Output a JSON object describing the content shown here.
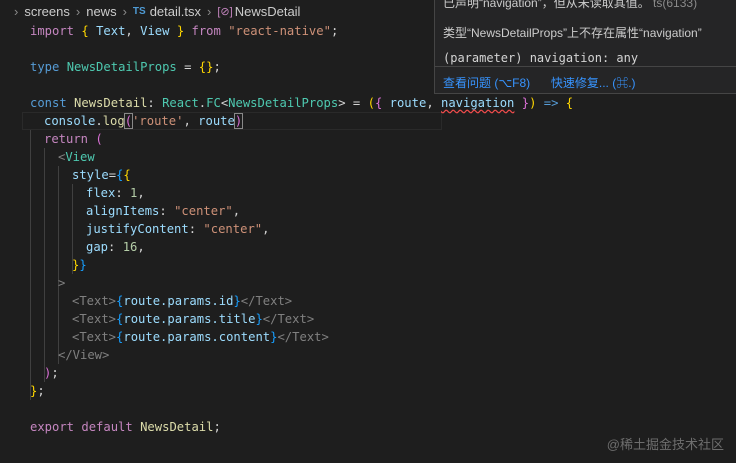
{
  "breadcrumb": {
    "items": [
      "screens",
      "news",
      "detail.tsx",
      "NewsDetail"
    ],
    "ts_badge": "TS",
    "sym_icon": "[⊘]"
  },
  "code": {
    "l1": [
      "import",
      "{",
      "Text",
      ",",
      "View",
      "}",
      "from",
      "\"react-native\"",
      ";"
    ],
    "l3": [
      "type",
      "NewsDetailProps",
      "=",
      "{}",
      ";"
    ],
    "l5": [
      "const",
      "NewsDetail",
      ":",
      "React",
      ".",
      "FC",
      "<",
      "NewsDetailProps",
      ">",
      "=",
      "(",
      "{",
      "route",
      ",",
      "navigation",
      "}",
      ")",
      "=>",
      "{"
    ],
    "l6": [
      "console",
      ".",
      "log",
      "(",
      "'route'",
      ",",
      "route",
      ")"
    ],
    "l7": [
      "return",
      "("
    ],
    "l8": [
      "<",
      "View"
    ],
    "l9": [
      "style",
      "=",
      "{",
      "{"
    ],
    "l10": [
      "flex",
      ":",
      "1",
      ","
    ],
    "l11": [
      "alignItems",
      ":",
      "\"center\"",
      ","
    ],
    "l12": [
      "justifyContent",
      ":",
      "\"center\"",
      ","
    ],
    "l13": [
      "gap",
      ":",
      "16",
      ","
    ],
    "l14": [
      "}",
      "}"
    ],
    "l15": [
      ">"
    ],
    "l16": [
      "<Text>",
      "{",
      "route.params.id",
      "}",
      "</Text>"
    ],
    "l17": [
      "<Text>",
      "{",
      "route.params.title",
      "}",
      "</Text>"
    ],
    "l18": [
      "<Text>",
      "{",
      "route.params.content",
      "}",
      "</Text>"
    ],
    "l19": [
      "</View>"
    ],
    "l20": [
      ")",
      ";"
    ],
    "l21": [
      "}",
      ";"
    ],
    "l23": [
      "export",
      "default",
      "NewsDetail",
      ";"
    ]
  },
  "hover": {
    "line1": "已声明“navigation”，但从未读取其值。",
    "line1_code": "ts(6133)",
    "line2": "类型“NewsDetailProps”上不存在属性“navigation”",
    "line3": "(parameter) navigation: any",
    "view_problem": "查看问题 (⌥F8)",
    "quick_fix": "快速修复... (⌘.)"
  },
  "watermark": "@稀土掘金技术社区",
  "colors": {
    "background": "#1e1e1e",
    "keyword": "#569cd6",
    "control_keyword": "#c586c0",
    "string": "#ce9178",
    "type": "#4ec9b0",
    "variable": "#9cdcfe",
    "function": "#dcdcaa",
    "number": "#b5cea8",
    "error": "#f14c4c",
    "link": "#3794ff"
  }
}
